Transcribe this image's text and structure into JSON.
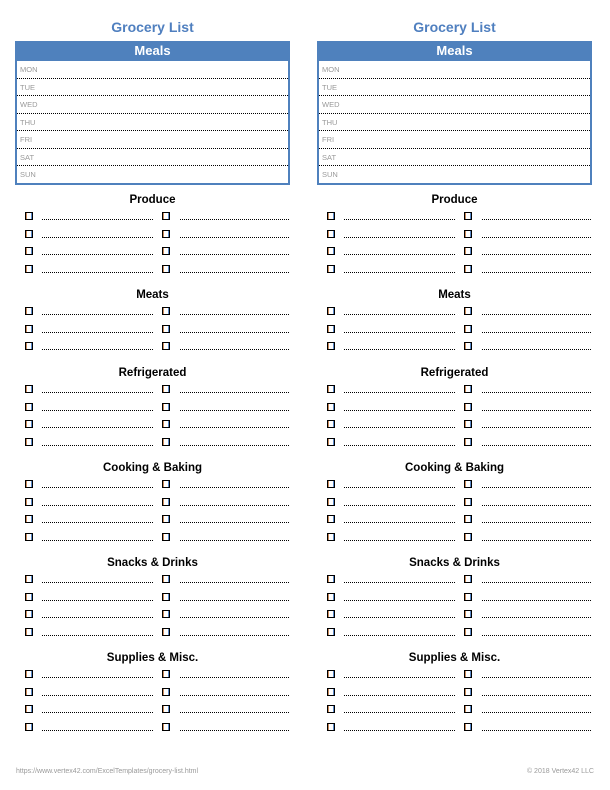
{
  "lists": [
    {
      "title": "Grocery List",
      "meals": {
        "header": "Meals",
        "days": [
          "MON",
          "TUE",
          "WED",
          "THU",
          "FRI",
          "SAT",
          "SUN"
        ]
      },
      "sections": [
        {
          "title": "Produce",
          "rows": 4
        },
        {
          "title": "Meats",
          "rows": 3
        },
        {
          "title": "Refrigerated",
          "rows": 4
        },
        {
          "title": "Cooking & Baking",
          "rows": 4
        },
        {
          "title": "Snacks & Drinks",
          "rows": 4
        },
        {
          "title": "Supplies & Misc.",
          "rows": 4
        }
      ]
    },
    {
      "title": "Grocery List",
      "meals": {
        "header": "Meals",
        "days": [
          "MON",
          "TUE",
          "WED",
          "THU",
          "FRI",
          "SAT",
          "SUN"
        ]
      },
      "sections": [
        {
          "title": "Produce",
          "rows": 4
        },
        {
          "title": "Meats",
          "rows": 3
        },
        {
          "title": "Refrigerated",
          "rows": 4
        },
        {
          "title": "Cooking & Baking",
          "rows": 4
        },
        {
          "title": "Snacks & Drinks",
          "rows": 4
        },
        {
          "title": "Supplies & Misc.",
          "rows": 4
        }
      ]
    }
  ],
  "footer": {
    "url": "https://www.vertex42.com/ExcelTemplates/grocery-list.html",
    "copyright": "© 2018 Vertex42 LLC"
  },
  "colors": {
    "accent": "#4f81bd",
    "title": "#4f7fbf",
    "muted_text": "#9a9a9a"
  }
}
